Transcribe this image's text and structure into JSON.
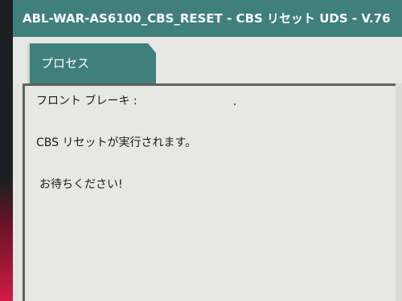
{
  "window": {
    "title": "ABL-WAR-AS6100_CBS_RESET - CBS リセット UDS - V.76"
  },
  "tabs": [
    {
      "label": "プロセス",
      "active": true
    }
  ],
  "content": {
    "lines": [
      "フロント ブレーキ :",
      "CBS リセットが実行されます。",
      "お待ちください!"
    ]
  },
  "colors": {
    "accent": "#3f7f7c",
    "panel_border": "#5e6461",
    "background": "#e4e5e1"
  }
}
